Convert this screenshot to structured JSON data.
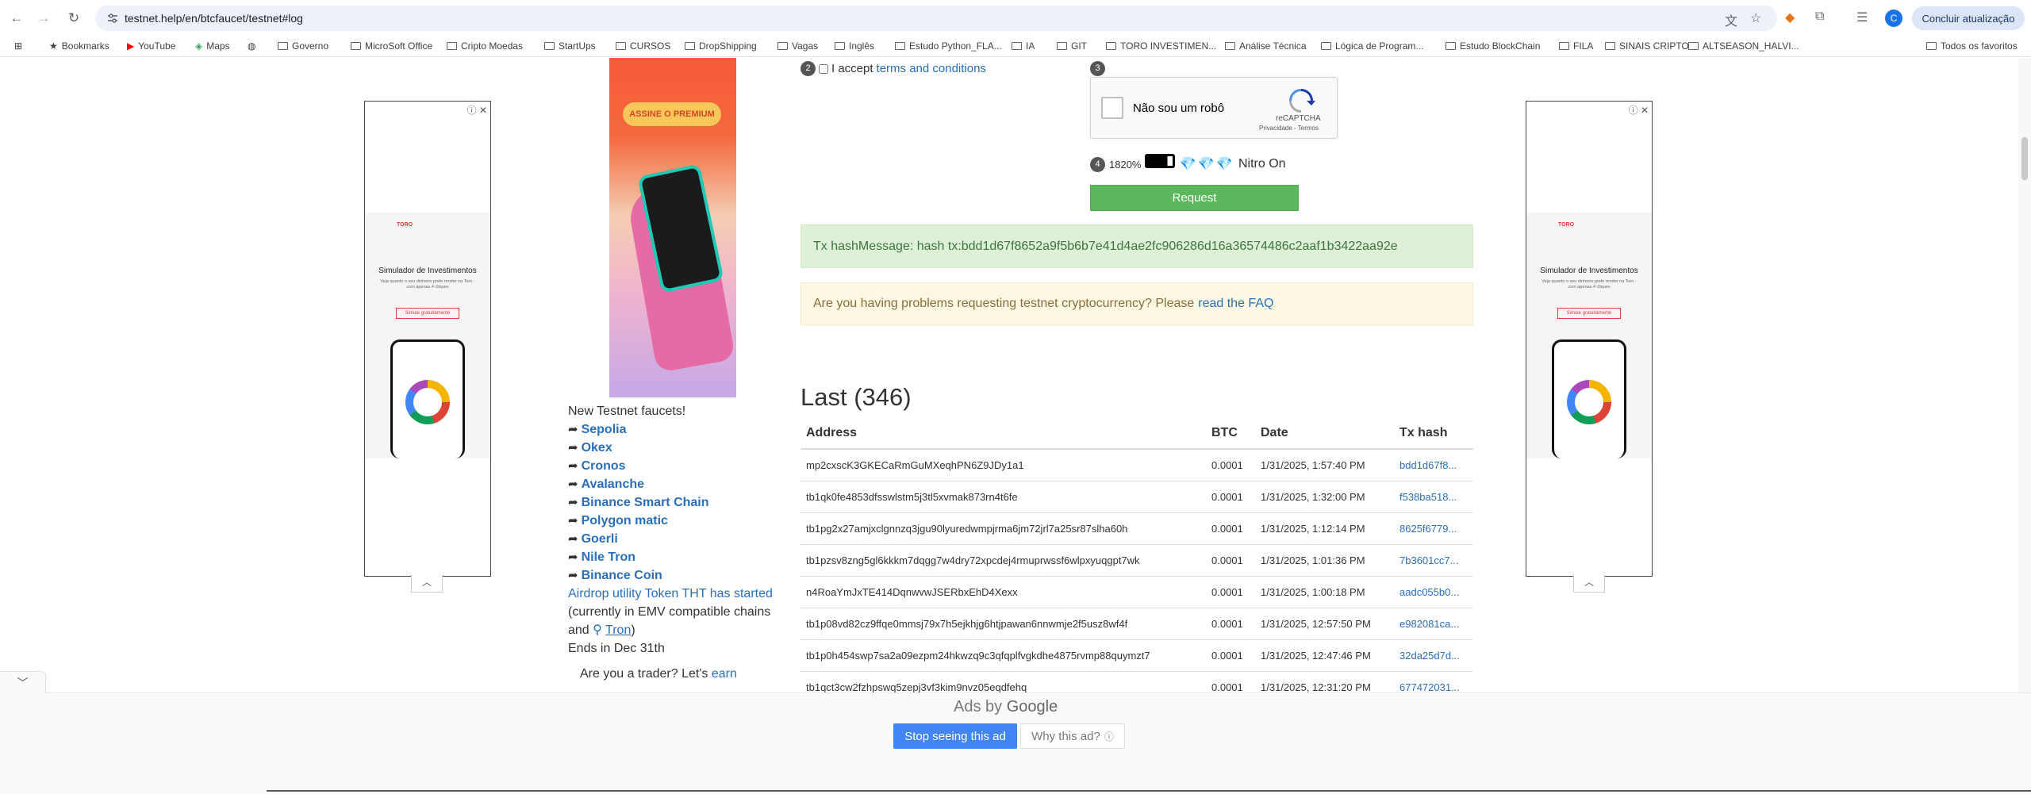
{
  "browser": {
    "url": "testnet.help/en/btcfaucet/testnet#log",
    "avatar_letter": "C",
    "update_button": "Concluir atualização",
    "bookmarks": [
      {
        "label": "Bookmarks",
        "icon": "star-icon"
      },
      {
        "label": "YouTube",
        "icon": "youtube-icon"
      },
      {
        "label": "Maps",
        "icon": "maps-icon"
      },
      {
        "label": "",
        "icon": "globe-icon"
      },
      {
        "label": "Governo",
        "icon": "folder-icon"
      },
      {
        "label": "MicroSoft Office",
        "icon": "folder-icon"
      },
      {
        "label": "Cripto Moedas",
        "icon": "folder-icon"
      },
      {
        "label": "StartUps",
        "icon": "folder-icon"
      },
      {
        "label": "CURSOS",
        "icon": "folder-icon"
      },
      {
        "label": "DropShipping",
        "icon": "folder-icon"
      },
      {
        "label": "Vagas",
        "icon": "folder-icon"
      },
      {
        "label": "Inglês",
        "icon": "folder-icon"
      },
      {
        "label": "Estudo Python_FLA...",
        "icon": "folder-icon"
      },
      {
        "label": "IA",
        "icon": "folder-icon"
      },
      {
        "label": "GIT",
        "icon": "folder-icon"
      },
      {
        "label": "TORO INVESTIMEN...",
        "icon": "folder-icon"
      },
      {
        "label": "Análise Técnica",
        "icon": "folder-icon"
      },
      {
        "label": "Lógica de Program...",
        "icon": "folder-icon"
      },
      {
        "label": "Estudo BlockChain",
        "icon": "folder-icon"
      },
      {
        "label": "FILA",
        "icon": "folder-icon"
      },
      {
        "label": "SINAIS CRIPTO",
        "icon": "folder-icon"
      },
      {
        "label": "ALTSEASON_HALVI...",
        "icon": "folder-icon"
      }
    ],
    "all_bookmarks": "Todos os favoritos"
  },
  "form": {
    "step2": "2",
    "accept_text": "I accept",
    "terms_link": "terms and conditions",
    "step3": "3",
    "captcha_label": "Não sou um robô",
    "captcha_brand": "reCAPTCHA",
    "captcha_privacy": "Privacidade - Termos",
    "step4": "4",
    "percent": "1820%",
    "nitro": "Nitro On",
    "request_button": "Request"
  },
  "alerts": {
    "success": "Tx hashMessage: hash tx:bdd1d67f8652a9f5b6b7e41d4ae2fc906286d16a36574486c2aaf1b3422aa92e",
    "warning_text": "Are you having problems requesting testnet cryptocurrency? Please",
    "warning_link": "read the FAQ"
  },
  "log": {
    "title": "Last (346)",
    "headers": [
      "Address",
      "BTC",
      "Date",
      "Tx hash"
    ],
    "rows": [
      [
        "mp2cxscK3GKECaRmGuMXeqhPN6Z9JDy1a1",
        "0.0001",
        "1/31/2025, 1:57:40 PM",
        "bdd1d67f8..."
      ],
      [
        "tb1qk0fe4853dfsswlstm5j3tl5xvmak873rn4t6fe",
        "0.0001",
        "1/31/2025, 1:32:00 PM",
        "f538ba518..."
      ],
      [
        "tb1pg2x27amjxclgnnzq3jgu90lyuredwmpjrma6jm72jrl7a25sr87slha60h",
        "0.0001",
        "1/31/2025, 1:12:14 PM",
        "8625f6779..."
      ],
      [
        "tb1pzsv8zng5gl6kkkm7dqgg7w4dry72xpcdej4rmuprwssf6wlpxyuqgpt7wk",
        "0.0001",
        "1/31/2025, 1:01:36 PM",
        "7b3601cc7..."
      ],
      [
        "n4RoaYmJxTE414DqnwvwJSERbxEhD4Xexx",
        "0.0001",
        "1/31/2025, 1:00:18 PM",
        "aadc055b0..."
      ],
      [
        "tb1p08vd82cz9ffqe0mmsj79x7h5ejkhjg6htjpawan6nnwmje2f5usz8wf4f",
        "0.0001",
        "1/31/2025, 12:57:50 PM",
        "e982081ca..."
      ],
      [
        "tb1p0h454swp7sa2a09ezpm24hkwzq9c3qfqplfvgkdhe4875rvmp88quymzt7",
        "0.0001",
        "1/31/2025, 12:47:46 PM",
        "32da25d7d..."
      ],
      [
        "tb1qct3cw2fzhpswq5zepj3vf3kim9nvz05eqdfehq",
        "0.0001",
        "1/31/2025, 12:31:20 PM",
        "677472031..."
      ]
    ]
  },
  "sidebar": {
    "heading": "New Testnet faucets!",
    "links": [
      "Sepolia",
      "Okex",
      "Cronos",
      "Avalanche",
      "Binance Smart Chain",
      "Polygon matic",
      "Goerli",
      "Nile Tron",
      "Binance Coin"
    ],
    "airdrop_link": "Airdrop utility Token THT has started",
    "airdrop_note_1": "(currently in EMV compatible chains",
    "airdrop_note_2": "and",
    "tron_link": "Tron",
    "airdrop_note_3": ")",
    "ends": "Ends in Dec 31th",
    "trader_text": "Are you a trader? Let's",
    "trader_link": "earn"
  },
  "ads": {
    "center_button": "ASSINE O PREMIUM",
    "side_title": "Simulador de Investimentos",
    "side_sub": "Veja quanto o seu dinheiro pode render na Toro - com apenas 4 cliques",
    "side_button": "Simule gratuitamente",
    "toro_brand": "TORO",
    "ads_by": "Ads by",
    "google": "Google",
    "stop_button": "Stop seeing this ad",
    "why_button": "Why this ad?"
  },
  "colors": {
    "link": "#2a6fb8",
    "request_green": "#5cb85c",
    "success_bg": "#dff0d8",
    "warning_bg": "#fcf8e3",
    "ad_blue": "#4285f4"
  }
}
